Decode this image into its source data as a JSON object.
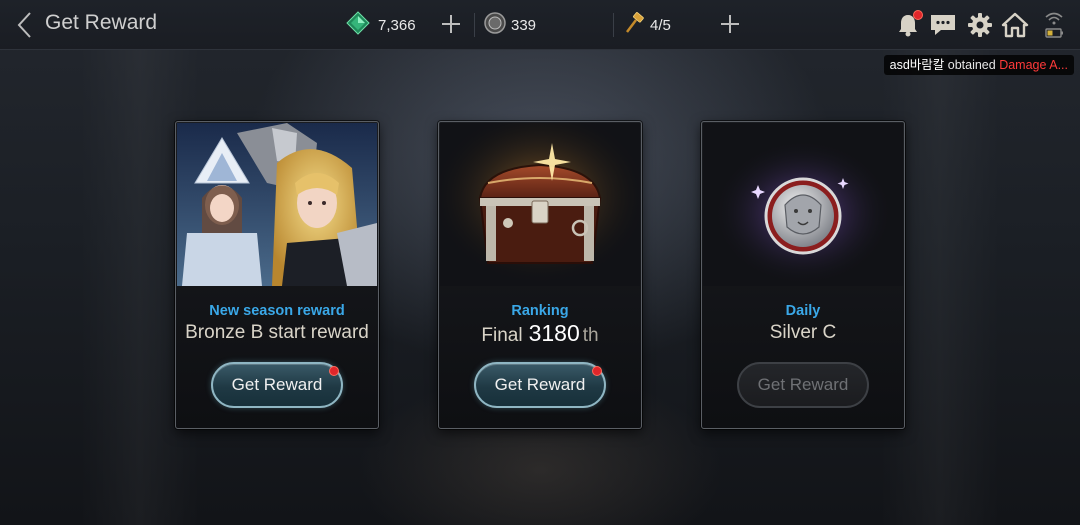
{
  "header": {
    "title": "Get Reward",
    "resources": {
      "gems": "7,366",
      "coins": "339",
      "stamina": "4/5"
    }
  },
  "notification": {
    "player": "asd바람칼",
    "text": " obtained ",
    "item": "Damage A..."
  },
  "cards": [
    {
      "label": "New season reward",
      "value": "Bronze B start reward",
      "button": "Get Reward",
      "button_state": "active",
      "has_alert": true
    },
    {
      "label": "Ranking",
      "value_prefix": "Final",
      "value_number": "3180",
      "value_suffix": "th",
      "button": "Get Reward",
      "button_state": "active",
      "has_alert": true
    },
    {
      "label": "Daily",
      "value": "Silver C",
      "button": "Get Reward",
      "button_state": "disabled",
      "has_alert": false
    }
  ],
  "colors": {
    "label_blue": "#3aa8e8",
    "alert_red": "#e0262b",
    "item_red": "#ff3a3a"
  },
  "icons": [
    "back-arrow-icon",
    "gem-icon",
    "coin-icon",
    "hammer-icon",
    "plus-icon",
    "bell-icon",
    "chat-icon",
    "gear-icon",
    "home-icon",
    "wifi-battery-icon"
  ]
}
